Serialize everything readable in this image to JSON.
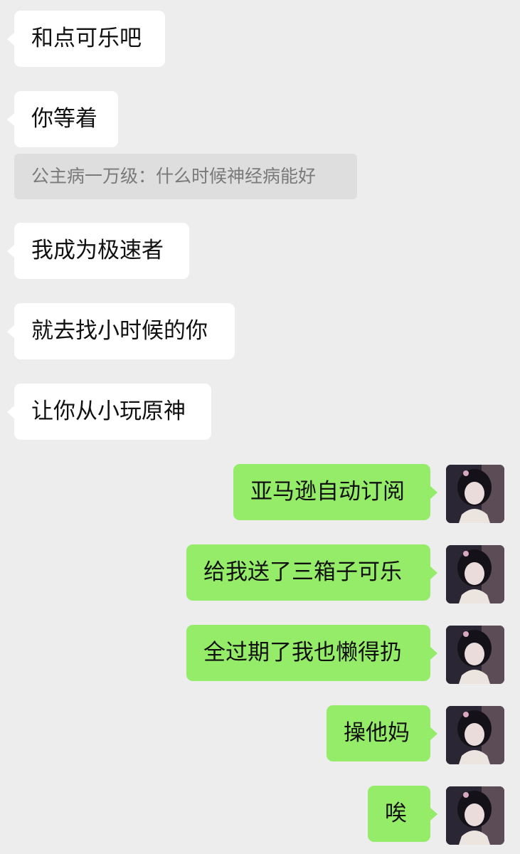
{
  "incoming": [
    {
      "text": "和点可乐吧"
    },
    {
      "text": "你等着"
    },
    {
      "text": "我成为极速者"
    },
    {
      "text": "就去找小时候的你"
    },
    {
      "text": "让你从小玩原神"
    }
  ],
  "quote": {
    "text": "公主病一万级：什么时候神经病能好"
  },
  "outgoing": [
    {
      "text": "亚马逊自动订阅"
    },
    {
      "text": "给我送了三箱子可乐"
    },
    {
      "text": "全过期了我也懒得扔"
    },
    {
      "text": "操他妈"
    },
    {
      "text": "唉"
    }
  ],
  "colors": {
    "background": "#ededed",
    "incoming_bubble": "#ffffff",
    "outgoing_bubble": "#95ec69",
    "quote_bg": "#dedede",
    "quote_text": "#7a7a7a"
  },
  "avatar": {
    "icon": "user-avatar-icon"
  }
}
